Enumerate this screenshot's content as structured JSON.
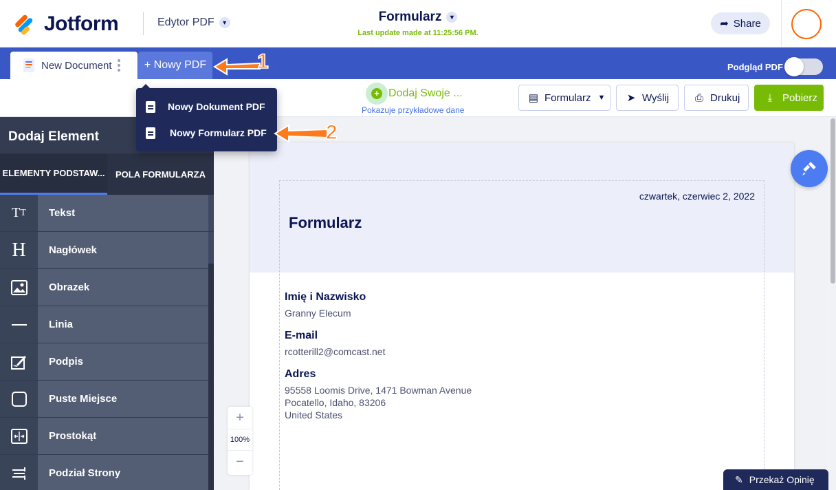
{
  "header": {
    "brand": "Jotform",
    "editor_mode": "Edytor PDF",
    "title": "Formularz",
    "last_update": "Last update made at 11:25:56 PM.",
    "share_label": "Share"
  },
  "tabbar": {
    "document_tab": "New Document",
    "new_pdf_label": "+ Nowy PDF",
    "preview_label": "Podgląd PDF",
    "preview_enabled": false
  },
  "toolbar": {
    "add_own_label": "Dodaj Swoje ...",
    "sample_note": "Pokazuje przykładowe dane",
    "form_label": "Formularz",
    "send_label": "Wyślij",
    "print_label": "Drukuj",
    "download_label": "Pobierz"
  },
  "dropdown": {
    "items": [
      {
        "label": "Nowy Dokument PDF",
        "icon": "document-icon"
      },
      {
        "label": "Nowy Formularz PDF",
        "icon": "form-edit-icon"
      }
    ]
  },
  "annotations": [
    "1",
    "2"
  ],
  "sidebar": {
    "title": "Dodaj Element",
    "tabs": [
      {
        "label": "ELEMENTY PODSTAW...",
        "active": true
      },
      {
        "label": "POLA FORMULARZA",
        "active": false
      }
    ],
    "items": [
      {
        "label": "Tekst",
        "icon": "text-size-icon",
        "glyph": "TT"
      },
      {
        "label": "Nagłówek",
        "icon": "heading-icon",
        "glyph": "H"
      },
      {
        "label": "Obrazek",
        "icon": "image-icon",
        "glyph": "▣"
      },
      {
        "label": "Linia",
        "icon": "line-icon",
        "glyph": "—"
      },
      {
        "label": "Podpis",
        "icon": "signature-icon",
        "glyph": "✎"
      },
      {
        "label": "Puste Miejsce",
        "icon": "empty-space-icon",
        "glyph": "▢"
      },
      {
        "label": "Prostokąt",
        "icon": "rectangle-icon",
        "glyph": "⇹"
      },
      {
        "label": "Podział Strony",
        "icon": "page-break-icon",
        "glyph": "≡"
      }
    ]
  },
  "document": {
    "date": "czwartek, czerwiec 2, 2022",
    "title": "Formularz",
    "fields": [
      {
        "label": "Imię i Nazwisko",
        "value_lines": [
          "Granny Elecum"
        ]
      },
      {
        "label": "E-mail",
        "value_lines": [
          "rcotterill2@comcast.net"
        ]
      },
      {
        "label": "Adres",
        "value_lines": [
          "95558 Loomis Drive, 1471 Bowman Avenue",
          "Pocatello, Idaho, 83206",
          "United States"
        ]
      }
    ]
  },
  "zoom": {
    "plus": "+",
    "value": "100%",
    "minus": "−"
  },
  "feedback_label": "Przekaż Opinię",
  "colors": {
    "accent_blue": "#3a57c6",
    "brand_green": "#78bb07",
    "annotation_orange": "#ff7a1a",
    "brand_orange": "#ff6100"
  }
}
